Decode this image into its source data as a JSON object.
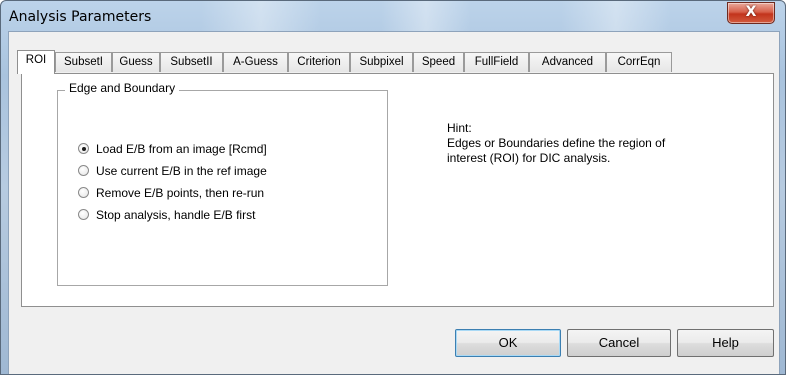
{
  "window": {
    "title": "Analysis Parameters",
    "close_label": "X"
  },
  "tabs": [
    {
      "label": "ROI",
      "active": true
    },
    {
      "label": "SubsetI",
      "active": false
    },
    {
      "label": "Guess",
      "active": false
    },
    {
      "label": "SubsetII",
      "active": false
    },
    {
      "label": "A-Guess",
      "active": false
    },
    {
      "label": "Criterion",
      "active": false
    },
    {
      "label": "Subpixel",
      "active": false
    },
    {
      "label": "Speed",
      "active": false
    },
    {
      "label": "FullField",
      "active": false
    },
    {
      "label": "Advanced",
      "active": false
    },
    {
      "label": "CorrEqn",
      "active": false
    }
  ],
  "group": {
    "title": "Edge and Boundary",
    "options": [
      {
        "label": "Load E/B from an image [Rcmd]",
        "selected": true
      },
      {
        "label": "Use current E/B in the ref image",
        "selected": false
      },
      {
        "label": "Remove E/B points, then re-run",
        "selected": false
      },
      {
        "label": "Stop analysis, handle E/B first",
        "selected": false
      }
    ]
  },
  "hint": {
    "title": "Hint:",
    "line1": "Edges or Boundaries define the region of",
    "line2": "interest (ROI) for DIC analysis."
  },
  "buttons": {
    "ok": "OK",
    "cancel": "Cancel",
    "help": "Help"
  }
}
